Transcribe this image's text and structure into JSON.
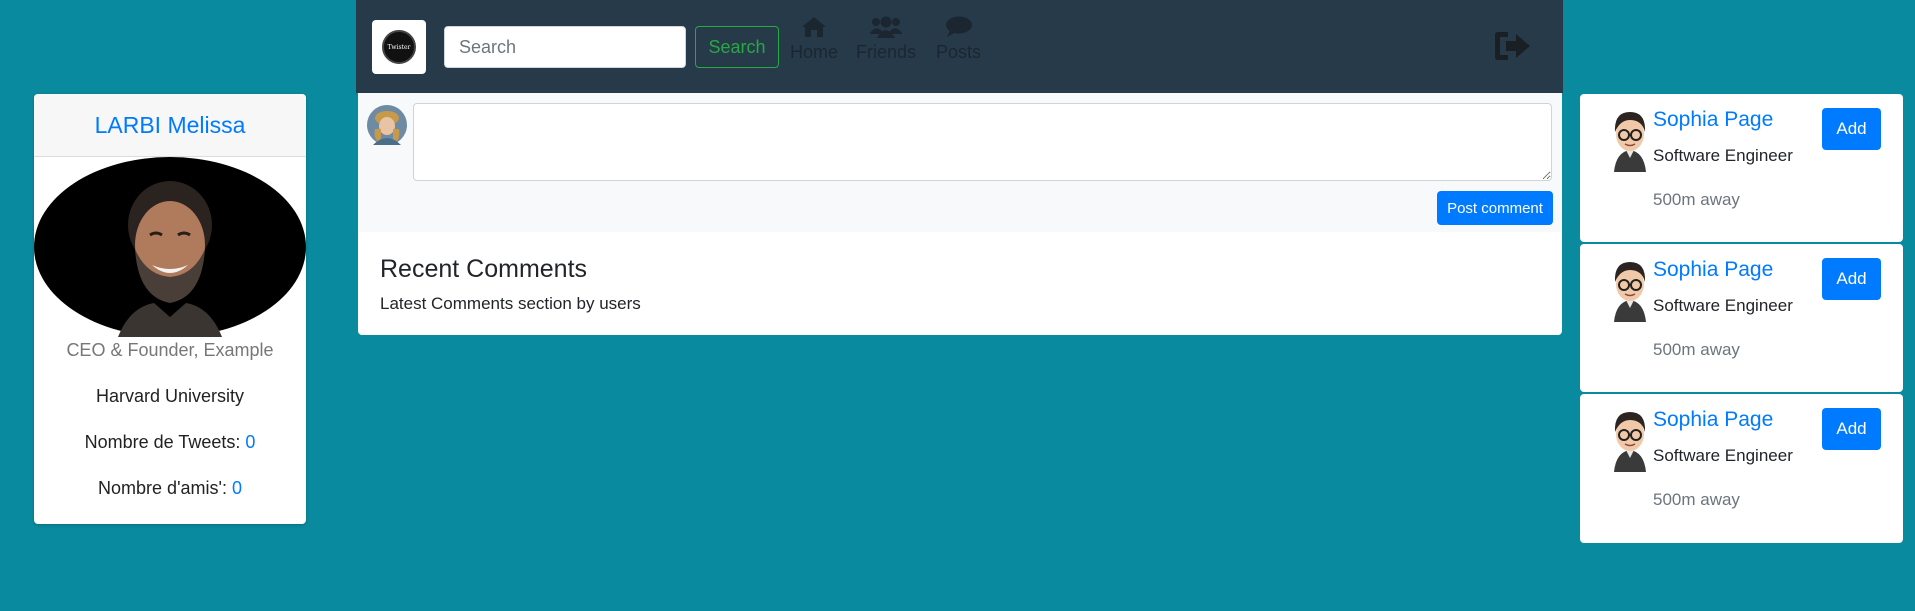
{
  "navbar": {
    "logo_text": "Twister",
    "search": {
      "placeholder": "Search",
      "value": ""
    },
    "search_button_label": "Search",
    "nav_items": [
      {
        "label": "Home",
        "icon": "home-icon"
      },
      {
        "label": "Friends",
        "icon": "users-icon"
      },
      {
        "label": "Posts",
        "icon": "comment-icon"
      }
    ],
    "logout_icon": "sign-out-icon"
  },
  "profile": {
    "name": "LARBI Melissa",
    "role": "CEO & Founder, Example",
    "university": "Harvard University",
    "tweets_label": "Nombre de Tweets: ",
    "tweets_count": "0",
    "friends_label": "Nombre d'amis': ",
    "friends_count": "0"
  },
  "compose": {
    "textarea_value": "",
    "post_button_label": "Post comment"
  },
  "recent_comments": {
    "title": "Recent Comments",
    "subtitle": "Latest Comments section by users"
  },
  "suggestions": [
    {
      "name": "Sophia Page",
      "job": "Software Engineer",
      "distance": "500m away",
      "button": "Add"
    },
    {
      "name": "Sophia Page",
      "job": "Software Engineer",
      "distance": "500m away",
      "button": "Add"
    },
    {
      "name": "Sophia Page",
      "job": "Software Engineer",
      "distance": "500m away",
      "button": "Add"
    }
  ],
  "colors": {
    "page_background": "#0a8a9e",
    "navbar": "#263a4a",
    "link_blue": "#007bff",
    "search_green": "#28a745"
  }
}
